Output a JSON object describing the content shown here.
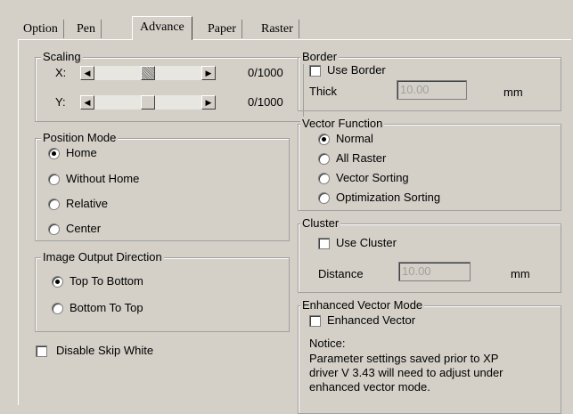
{
  "tabs": [
    "Option",
    "Pen",
    "Advance",
    "Paper",
    "Raster"
  ],
  "scaling": {
    "legend": "Scaling",
    "x_label": "X:",
    "y_label": "Y:",
    "x_value": "0/1000",
    "y_value": "0/1000",
    "left_arrow": "◀",
    "right_arrow": "▶"
  },
  "position_mode": {
    "legend": "Position Mode",
    "options": [
      "Home",
      "Without Home",
      "Relative",
      "Center"
    ],
    "selected": "Home"
  },
  "image_output": {
    "legend": "Image Output Direction",
    "options": [
      "Top To Bottom",
      "Bottom To Top"
    ],
    "selected": "Top To Bottom"
  },
  "disable_skip_white": "Disable Skip White",
  "border": {
    "legend": "Border",
    "use_label": "Use Border",
    "thick_label": "Thick",
    "thick_value": "10.00",
    "unit": "mm"
  },
  "vector_function": {
    "legend": "Vector Function",
    "options": [
      "Normal",
      "All Raster",
      "Vector Sorting",
      "Optimization Sorting"
    ],
    "selected": "Normal"
  },
  "cluster": {
    "legend": "Cluster",
    "use_label": "Use Cluster",
    "distance_label": "Distance",
    "distance_value": "10.00",
    "unit": "mm"
  },
  "enhanced": {
    "legend": "Enhanced Vector Mode",
    "check_label": "Enhanced Vector",
    "notice_title": "Notice:",
    "notice_lines": [
      "Parameter settings saved prior to XP",
      "driver V 3.43 will need to adjust under",
      "enhanced vector mode."
    ]
  }
}
